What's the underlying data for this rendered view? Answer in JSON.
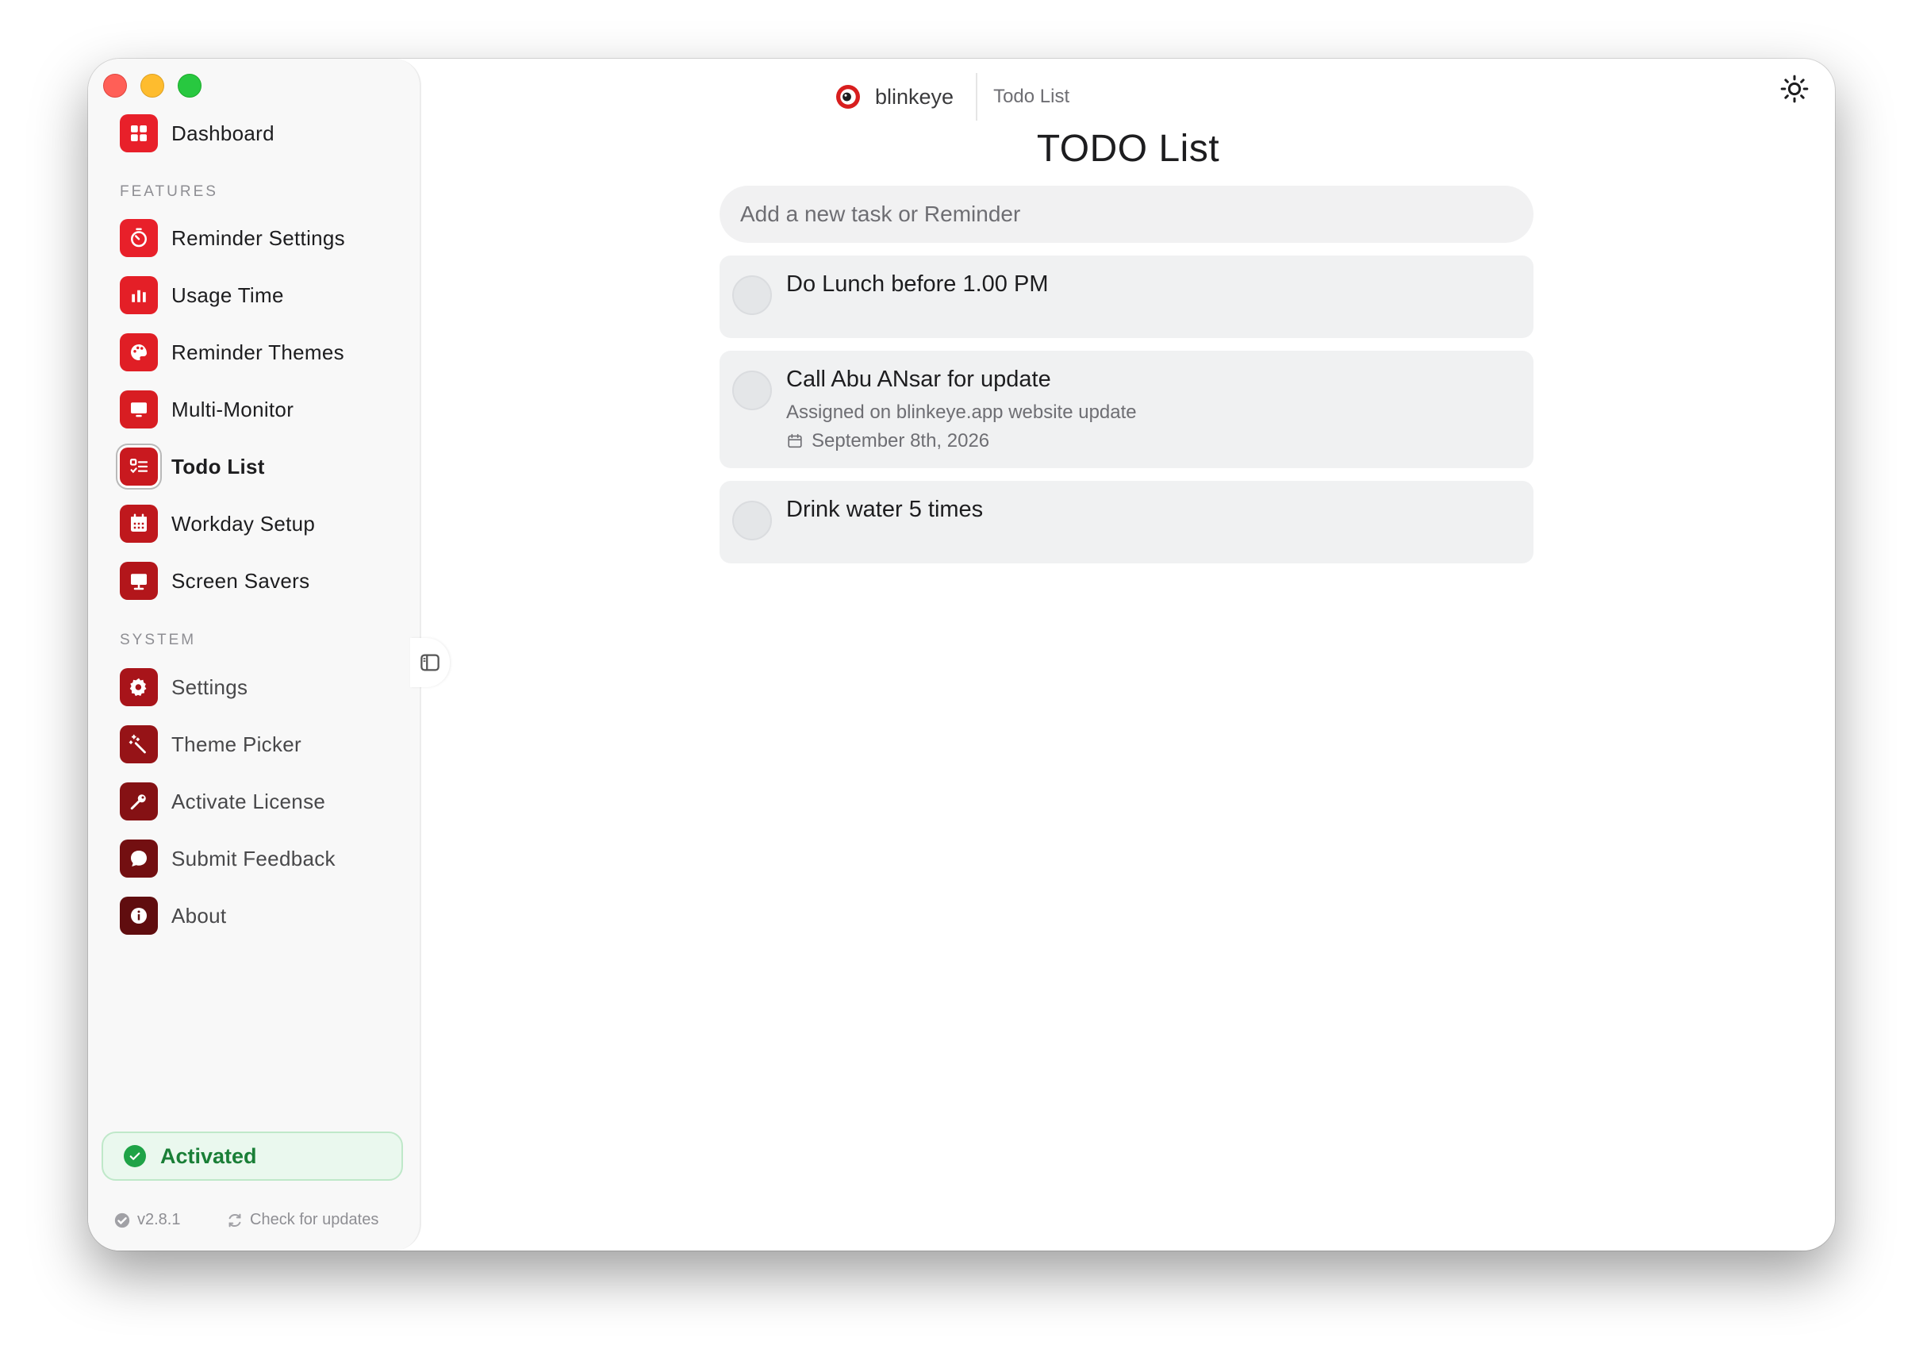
{
  "app": {
    "brand": "blinkeye",
    "breadcrumb": "Todo List"
  },
  "sidebar": {
    "dashboard": {
      "label": "Dashboard",
      "icon": "dashboard-icon"
    },
    "features_heading": "FEATURES",
    "features": [
      {
        "label": "Reminder Settings",
        "icon": "timer-icon"
      },
      {
        "label": "Usage Time",
        "icon": "bar-chart-icon"
      },
      {
        "label": "Reminder Themes",
        "icon": "palette-icon"
      },
      {
        "label": "Multi-Monitor",
        "icon": "monitor-icon"
      },
      {
        "label": "Todo List",
        "icon": "checklist-icon",
        "active": true
      },
      {
        "label": "Workday Setup",
        "icon": "calendar-icon"
      },
      {
        "label": "Screen Savers",
        "icon": "display-icon"
      }
    ],
    "system_heading": "SYSTEM",
    "system": [
      {
        "label": "Settings",
        "icon": "gear-icon"
      },
      {
        "label": "Theme Picker",
        "icon": "magic-wand-icon"
      },
      {
        "label": "Activate License",
        "icon": "key-icon"
      },
      {
        "label": "Submit Feedback",
        "icon": "chat-bubble-icon"
      },
      {
        "label": "About",
        "icon": "info-icon"
      }
    ],
    "license_status": "Activated",
    "version": "v2.8.1",
    "check_updates": "Check for updates"
  },
  "main": {
    "title": "TODO List",
    "input_placeholder": "Add a new task or Reminder",
    "tasks": [
      {
        "title": "Do Lunch before 1.00 PM"
      },
      {
        "title": "Call Abu ANsar for update",
        "description": "Assigned on blinkeye.app website update",
        "date": "September 8th, 2026"
      },
      {
        "title": "Drink water 5 times"
      }
    ]
  },
  "colors": {
    "accent": "#d81e1e",
    "activated_text": "#1a7f37",
    "activated_bg": "#eaf8ee"
  }
}
